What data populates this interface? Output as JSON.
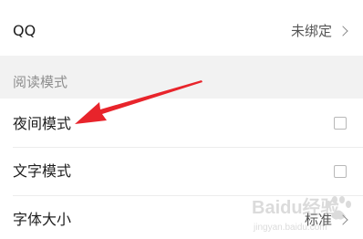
{
  "settings": {
    "qq": {
      "label": "QQ",
      "value": "未绑定"
    },
    "reading_section": {
      "title": "阅读模式"
    },
    "night_mode": {
      "label": "夜间模式",
      "checked": false
    },
    "text_mode": {
      "label": "文字模式",
      "checked": false
    },
    "font_size": {
      "label": "字体大小",
      "value": "标准"
    }
  },
  "icons": {
    "chevron": "chevron-right-icon",
    "checkbox": "checkbox-icon",
    "arrow": "red-annotation-arrow"
  },
  "colors": {
    "annotation": "#e8242b",
    "section_bg": "#f2f2f2"
  },
  "watermark": {
    "brand": "Baidu经验",
    "url": "jingyan.baidu.com"
  }
}
